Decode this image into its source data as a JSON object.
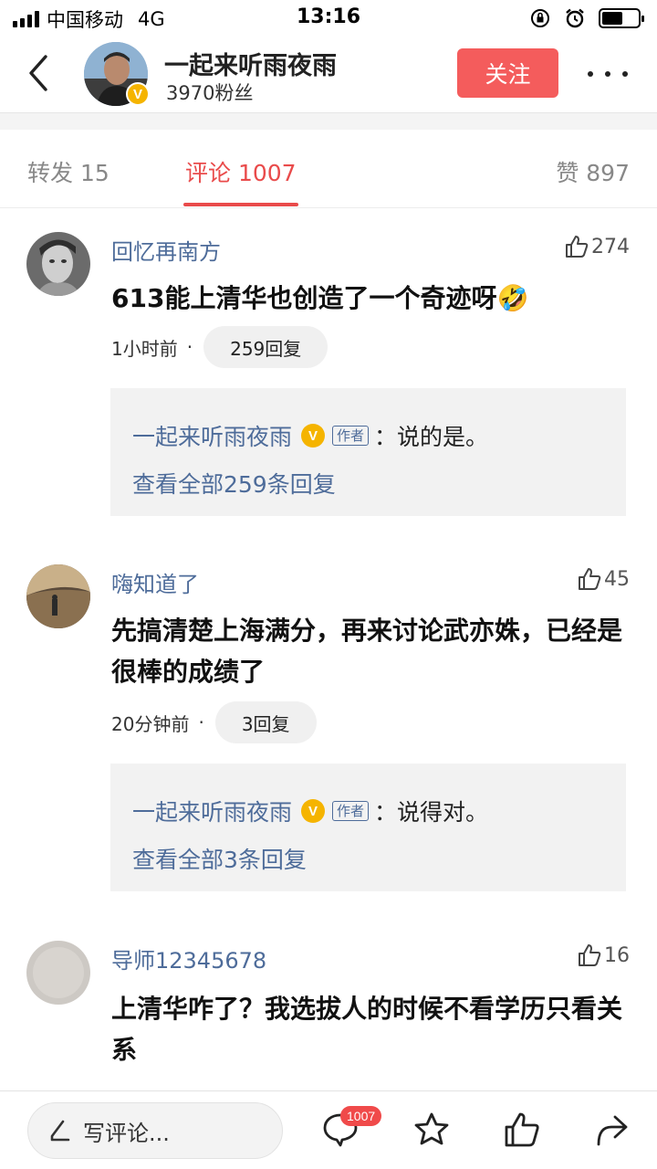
{
  "status_bar": {
    "carrier": "中国移动",
    "network": "4G",
    "time": "13:16"
  },
  "header": {
    "back_icon": "chevron-left-icon",
    "author_name": "一起来听雨夜雨",
    "verified_badge": "V",
    "fans": "3970粉丝",
    "follow_label": "关注",
    "more_icon": "more-dots-icon"
  },
  "tabs": {
    "forward": "转发 15",
    "comments": "评论 1007",
    "likes": "赞 897",
    "active": "comments"
  },
  "comments": [
    {
      "user": "回忆再南方",
      "likes": "274",
      "text": "613能上清华也创造了一个奇迹呀🤣",
      "time": "1小时前",
      "dot": "·",
      "reply_count": "259回复",
      "author_reply": {
        "author": "一起来听雨夜雨",
        "v": "V",
        "tag": "作者",
        "text": "：说的是。",
        "view_all": "查看全部259条回复"
      }
    },
    {
      "user": "嗨知道了",
      "likes": "45",
      "text": "先搞清楚上海满分，再来讨论武亦姝，已经是很棒的成绩了",
      "time": "20分钟前",
      "dot": "·",
      "reply_count": "3回复",
      "author_reply": {
        "author": "一起来听雨夜雨",
        "v": "V",
        "tag": "作者",
        "text": "：说得对。",
        "view_all": "查看全部3条回复"
      }
    },
    {
      "user": "导师12345678",
      "likes": "16",
      "text": "上清华咋了？我选拔人的时候不看学历只看关系"
    }
  ],
  "bottom_bar": {
    "write_placeholder": "写评论...",
    "comment_badge": "1007",
    "icons": [
      "pen-icon",
      "comment-icon",
      "star-icon",
      "thumb-up-icon",
      "share-icon"
    ]
  },
  "colors": {
    "accent_red": "#f45c5c",
    "link_blue": "#4e6c9a",
    "verified_gold": "#f5b400"
  }
}
